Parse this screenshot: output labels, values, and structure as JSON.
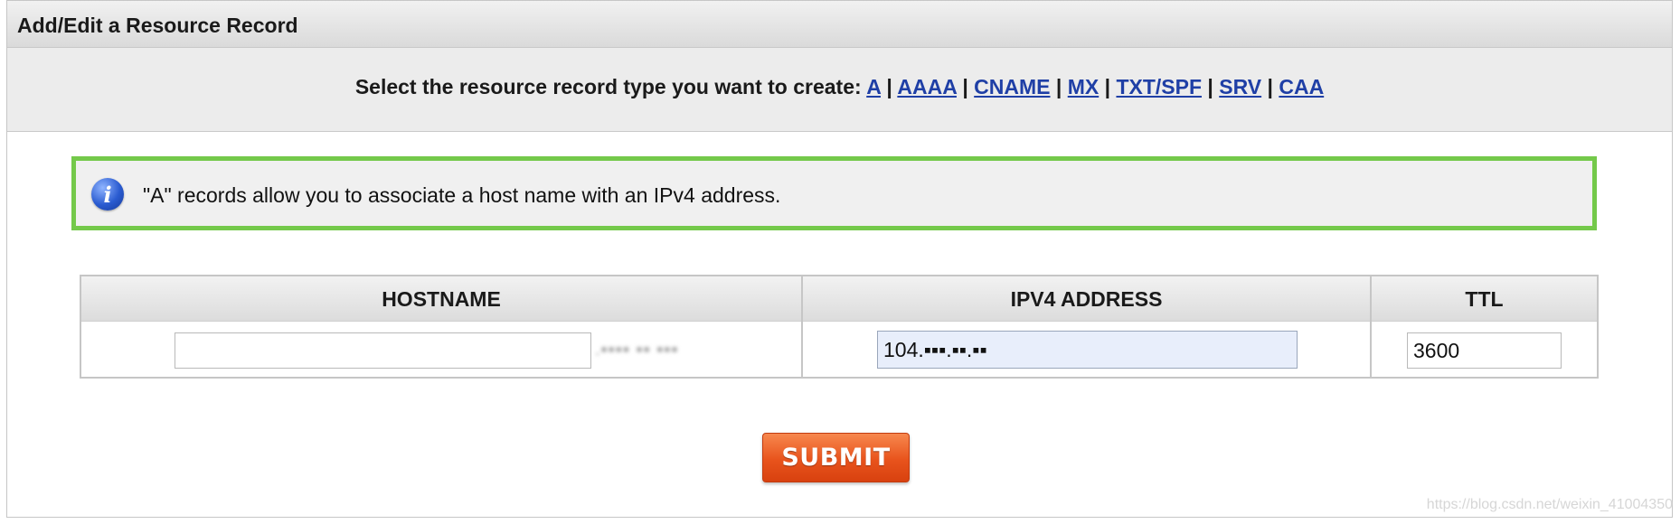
{
  "panel": {
    "title": "Add/Edit a Resource Record"
  },
  "type_select": {
    "prompt": "Select the resource record type you want to create:",
    "separator": "|",
    "types": [
      "A",
      "AAAA",
      "CNAME",
      "MX",
      "TXT/SPF",
      "SRV",
      "CAA"
    ]
  },
  "info": {
    "icon": "info-icon",
    "icon_glyph": "i",
    "message": "\"A\" records allow you to associate a host name with an IPv4 address.",
    "border_color": "#74c94a"
  },
  "table": {
    "columns": [
      "HOSTNAME",
      "IPV4 ADDRESS",
      "TTL"
    ],
    "hostname": {
      "value": "",
      "suffix": ".▪▪▪▪ ▪▪ ▪▪▪"
    },
    "ipv4": {
      "value": "104.▪▪▪.▪▪.▪▪"
    },
    "ttl": {
      "value": "3600"
    }
  },
  "submit": {
    "label": "SUBMIT",
    "color": "#e8531c"
  },
  "watermark": "https://blog.csdn.net/weixin_41004350"
}
